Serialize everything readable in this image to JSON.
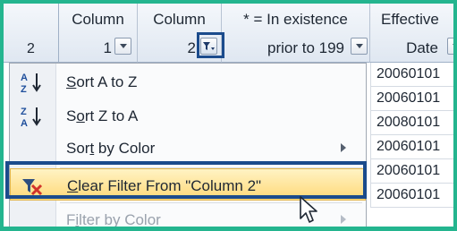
{
  "header": {
    "row_number": "2",
    "columns": [
      {
        "title": "Column",
        "value": "1"
      },
      {
        "title": "Column",
        "value": "2"
      },
      {
        "title": "* = In existence",
        "value": "prior to 199"
      },
      {
        "title": "Effective",
        "value": "Date"
      }
    ]
  },
  "effective_dates": [
    "20060101",
    "20060101",
    "20080101",
    "20060101",
    "20060101",
    "20060101"
  ],
  "menu": {
    "items": [
      {
        "label_pre": "",
        "label_key": "S",
        "label_post": "ort A to Z"
      },
      {
        "label_pre": "S",
        "label_key": "o",
        "label_post": "rt Z to A"
      },
      {
        "label_pre": "Sor",
        "label_key": "t",
        "label_post": " by Color"
      },
      {
        "label_pre": "",
        "label_key": "C",
        "label_post": "lear Filter From \"Column 2\""
      },
      {
        "label_pre": "F",
        "label_key": "i",
        "label_post": "lter by Color"
      }
    ]
  },
  "colors": {
    "frame": "#24b58f",
    "highlight_border": "#1b4b8c",
    "menu_hover": "#ffd978"
  }
}
